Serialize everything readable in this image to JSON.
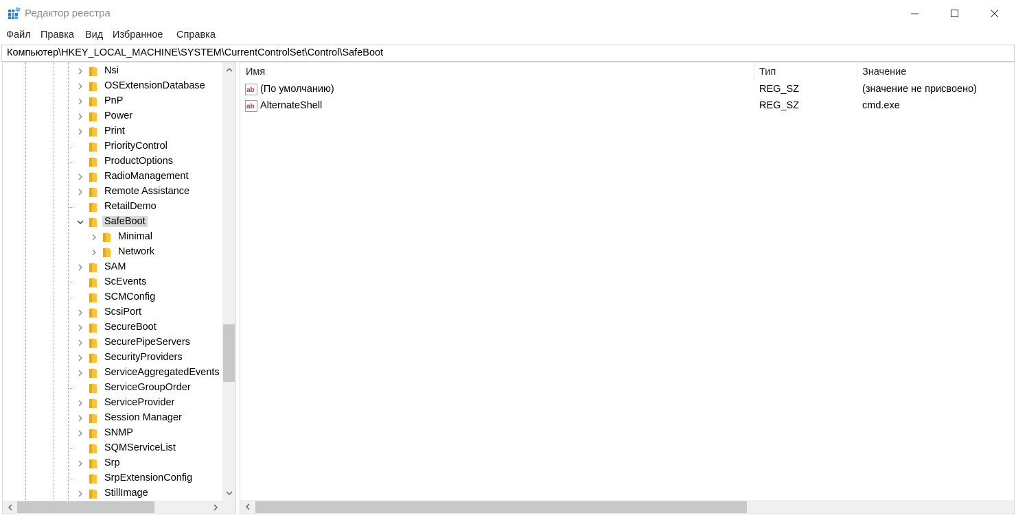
{
  "window": {
    "title": "Редактор реестра",
    "minimize_icon": "minimize-icon",
    "maximize_icon": "maximize-icon",
    "close_icon": "close-icon"
  },
  "menu": {
    "items": [
      "Файл",
      "Правка",
      "Вид",
      "Избранное",
      "Справка"
    ]
  },
  "address": {
    "path": "Компьютер\\HKEY_LOCAL_MACHINE\\SYSTEM\\CurrentControlSet\\Control\\SafeBoot"
  },
  "tree": {
    "items": [
      {
        "label": "Nsi",
        "expandable": true,
        "level": 0
      },
      {
        "label": "OSExtensionDatabase",
        "expandable": true,
        "level": 0
      },
      {
        "label": "PnP",
        "expandable": true,
        "level": 0
      },
      {
        "label": "Power",
        "expandable": true,
        "level": 0
      },
      {
        "label": "Print",
        "expandable": true,
        "level": 0
      },
      {
        "label": "PriorityControl",
        "expandable": false,
        "level": 0
      },
      {
        "label": "ProductOptions",
        "expandable": false,
        "level": 0
      },
      {
        "label": "RadioManagement",
        "expandable": true,
        "level": 0
      },
      {
        "label": "Remote Assistance",
        "expandable": true,
        "level": 0
      },
      {
        "label": "RetailDemo",
        "expandable": false,
        "level": 0
      },
      {
        "label": "SafeBoot",
        "expandable": true,
        "expanded": true,
        "selected": true,
        "level": 0
      },
      {
        "label": "Minimal",
        "expandable": true,
        "level": 1
      },
      {
        "label": "Network",
        "expandable": true,
        "level": 1
      },
      {
        "label": "SAM",
        "expandable": true,
        "level": 0
      },
      {
        "label": "ScEvents",
        "expandable": false,
        "level": 0
      },
      {
        "label": "SCMConfig",
        "expandable": false,
        "level": 0
      },
      {
        "label": "ScsiPort",
        "expandable": true,
        "level": 0
      },
      {
        "label": "SecureBoot",
        "expandable": true,
        "level": 0
      },
      {
        "label": "SecurePipeServers",
        "expandable": true,
        "level": 0
      },
      {
        "label": "SecurityProviders",
        "expandable": true,
        "level": 0
      },
      {
        "label": "ServiceAggregatedEvents",
        "expandable": true,
        "level": 0
      },
      {
        "label": "ServiceGroupOrder",
        "expandable": false,
        "level": 0
      },
      {
        "label": "ServiceProvider",
        "expandable": true,
        "level": 0
      },
      {
        "label": "Session Manager",
        "expandable": true,
        "level": 0
      },
      {
        "label": "SNMP",
        "expandable": true,
        "level": 0
      },
      {
        "label": "SQMServiceList",
        "expandable": false,
        "level": 0
      },
      {
        "label": "Srp",
        "expandable": true,
        "level": 0
      },
      {
        "label": "SrpExtensionConfig",
        "expandable": false,
        "level": 0
      },
      {
        "label": "StillImage",
        "expandable": true,
        "level": 0
      }
    ]
  },
  "values": {
    "columns": {
      "name": "Имя",
      "type": "Тип",
      "data": "Значение"
    },
    "rows": [
      {
        "name": "(По умолчанию)",
        "type": "REG_SZ",
        "data": "(значение не присвоено)",
        "icon": "string-value-icon"
      },
      {
        "name": "AlternateShell",
        "type": "REG_SZ",
        "data": "cmd.exe",
        "icon": "string-value-icon"
      }
    ]
  },
  "colors": {
    "folder": "#F5C342",
    "selection": "#D9D9D9",
    "scrollbar_track": "#F0F0F0",
    "scrollbar_thumb": "#C8C8C8"
  }
}
